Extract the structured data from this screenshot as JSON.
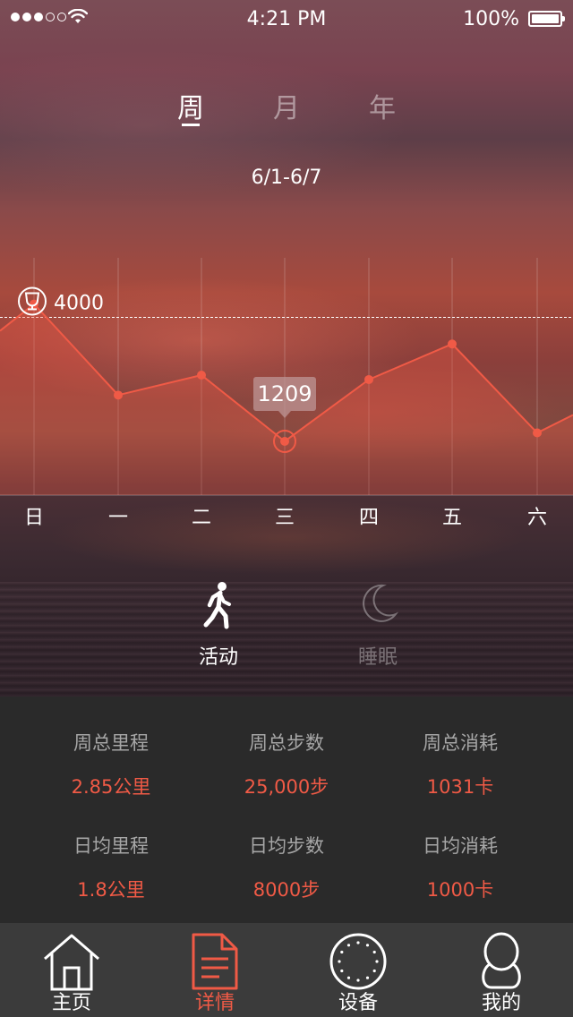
{
  "status_bar": {
    "signal_dots_filled": 3,
    "signal_dots_total": 5,
    "time": "4:21 PM",
    "battery": "100%"
  },
  "period_tabs": [
    {
      "label": "周",
      "active": true
    },
    {
      "label": "月",
      "active": false
    },
    {
      "label": "年",
      "active": false
    }
  ],
  "date_range": "6/1-6/7",
  "goal": {
    "icon": "trophy-icon",
    "value": "4000"
  },
  "chart_data": {
    "type": "line",
    "categories": [
      "日",
      "一",
      "二",
      "三",
      "四",
      "五",
      "六"
    ],
    "values": [
      4300,
      2250,
      2700,
      1209,
      2600,
      3400,
      1400
    ],
    "selected_index": 3,
    "selected_label": "1209",
    "goal_line": 4000,
    "ylim": [
      0,
      5500
    ],
    "line_color": "#f05a46"
  },
  "modes": [
    {
      "label": "活动",
      "icon": "walking-person-icon",
      "active": true
    },
    {
      "label": "睡眠",
      "icon": "moon-icon",
      "active": false
    }
  ],
  "stats": [
    {
      "key": "周总里程",
      "value": "2.85公里"
    },
    {
      "key": "周总步数",
      "value": "25,000步"
    },
    {
      "key": "周总消耗",
      "value": "1031卡"
    },
    {
      "key": "日均里程",
      "value": "1.8公里"
    },
    {
      "key": "日均步数",
      "value": "8000步"
    },
    {
      "key": "日均消耗",
      "value": "1000卡"
    }
  ],
  "tab_bar": [
    {
      "label": "主页",
      "icon": "home-icon",
      "active": false
    },
    {
      "label": "详情",
      "icon": "document-icon",
      "active": true
    },
    {
      "label": "设备",
      "icon": "device-watch-icon",
      "active": false
    },
    {
      "label": "我的",
      "icon": "user-icon",
      "active": false
    }
  ],
  "colors": {
    "accent": "#f05a46",
    "stats_bg": "#2a2a2a",
    "tabbar_bg": "#3b3b3b"
  }
}
